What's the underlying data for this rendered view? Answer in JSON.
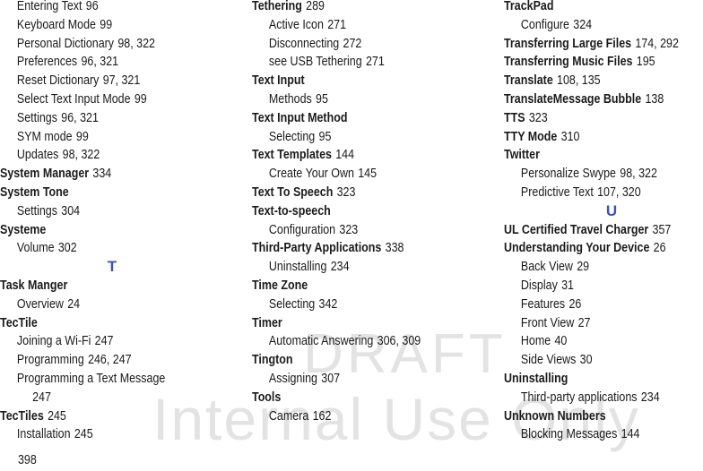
{
  "watermark": {
    "line1": "DRAFT",
    "line2": "Internal Use Only"
  },
  "page_number": "398",
  "accent_color": "#3f51b5",
  "columns": [
    {
      "entries": [
        {
          "type": "sub",
          "term": "Entering Text",
          "pages": "96"
        },
        {
          "type": "sub",
          "term": "Keyboard Mode",
          "pages": "99"
        },
        {
          "type": "sub",
          "term": "Personal Dictionary",
          "pages": "98, 322"
        },
        {
          "type": "sub",
          "term": "Preferences",
          "pages": "96, 321"
        },
        {
          "type": "sub",
          "term": "Reset Dictionary",
          "pages": "97, 321"
        },
        {
          "type": "sub",
          "term": "Select Text Input Mode",
          "pages": "99"
        },
        {
          "type": "sub",
          "term": "Settings",
          "pages": "96, 321"
        },
        {
          "type": "sub",
          "term": "SYM mode",
          "pages": "99"
        },
        {
          "type": "sub",
          "term": "Updates",
          "pages": "98, 322"
        },
        {
          "type": "main",
          "term": "System Manager",
          "pages": "334"
        },
        {
          "type": "main",
          "term": "System Tone",
          "pages": ""
        },
        {
          "type": "sub",
          "term": "Settings",
          "pages": "304"
        },
        {
          "type": "main",
          "term": "Systeme",
          "pages": ""
        },
        {
          "type": "sub",
          "term": "Volume",
          "pages": "302"
        },
        {
          "type": "letter",
          "term": "T",
          "pages": ""
        },
        {
          "type": "main",
          "term": "Task Manger",
          "pages": ""
        },
        {
          "type": "sub",
          "term": "Overview",
          "pages": "24"
        },
        {
          "type": "main",
          "term": "TecTile",
          "pages": ""
        },
        {
          "type": "sub",
          "term": "Joining a Wi-Fi",
          "pages": "247"
        },
        {
          "type": "sub",
          "term": "Programming",
          "pages": "246, 247"
        },
        {
          "type": "sub",
          "term": "Programming a Text Message",
          "pages": ""
        },
        {
          "type": "cont",
          "term": "",
          "pages": "247"
        },
        {
          "type": "main",
          "term": "TecTiles",
          "pages": "245"
        },
        {
          "type": "sub",
          "term": "Installation",
          "pages": "245"
        }
      ]
    },
    {
      "entries": [
        {
          "type": "main",
          "term": "Tethering",
          "pages": "289"
        },
        {
          "type": "sub",
          "term": "Active Icon",
          "pages": "271"
        },
        {
          "type": "sub",
          "term": "Disconnecting",
          "pages": "272"
        },
        {
          "type": "sub",
          "term": "see USB Tethering",
          "pages": "271"
        },
        {
          "type": "main",
          "term": "Text Input",
          "pages": ""
        },
        {
          "type": "sub",
          "term": "Methods",
          "pages": "95"
        },
        {
          "type": "main",
          "term": "Text Input Method",
          "pages": ""
        },
        {
          "type": "sub",
          "term": "Selecting",
          "pages": "95"
        },
        {
          "type": "main",
          "term": "Text Templates",
          "pages": "144"
        },
        {
          "type": "sub",
          "term": "Create Your Own",
          "pages": "145"
        },
        {
          "type": "main",
          "term": "Text To Speech",
          "pages": "323"
        },
        {
          "type": "main",
          "term": "Text-to-speech",
          "pages": ""
        },
        {
          "type": "sub",
          "term": "Configuration",
          "pages": "323"
        },
        {
          "type": "main",
          "term": "Third-Party Applications",
          "pages": "338"
        },
        {
          "type": "sub",
          "term": "Uninstalling",
          "pages": "234"
        },
        {
          "type": "main",
          "term": "Time Zone",
          "pages": ""
        },
        {
          "type": "sub",
          "term": "Selecting",
          "pages": "342"
        },
        {
          "type": "main",
          "term": "Timer",
          "pages": ""
        },
        {
          "type": "sub",
          "term": "Automatic Answering",
          "pages": "306, 309"
        },
        {
          "type": "main",
          "term": "Tington",
          "pages": ""
        },
        {
          "type": "sub",
          "term": "Assigning",
          "pages": "307"
        },
        {
          "type": "main",
          "term": "Tools",
          "pages": ""
        },
        {
          "type": "sub",
          "term": "Camera",
          "pages": "162"
        }
      ]
    },
    {
      "entries": [
        {
          "type": "main",
          "term": "TrackPad",
          "pages": ""
        },
        {
          "type": "sub",
          "term": "Configure",
          "pages": "324"
        },
        {
          "type": "main",
          "term": "Transferring Large Files",
          "pages": "174, 292"
        },
        {
          "type": "main",
          "term": "Transferring Music Files",
          "pages": "195"
        },
        {
          "type": "main",
          "term": "Translate",
          "pages": "108, 135"
        },
        {
          "type": "main",
          "term": "TranslateMessage Bubble",
          "pages": "138"
        },
        {
          "type": "main",
          "term": "TTS",
          "pages": "323"
        },
        {
          "type": "main",
          "term": "TTY Mode",
          "pages": "310"
        },
        {
          "type": "main",
          "term": "Twitter",
          "pages": ""
        },
        {
          "type": "sub",
          "term": "Personalize Swype",
          "pages": "98, 322"
        },
        {
          "type": "sub",
          "term": "Predictive Text",
          "pages": "107, 320"
        },
        {
          "type": "letter",
          "term": "U",
          "pages": ""
        },
        {
          "type": "main",
          "term": "UL Certified Travel Charger",
          "pages": "357"
        },
        {
          "type": "main",
          "term": "Understanding Your Device",
          "pages": "26"
        },
        {
          "type": "sub",
          "term": "Back View",
          "pages": "29"
        },
        {
          "type": "sub",
          "term": "Display",
          "pages": "31"
        },
        {
          "type": "sub",
          "term": "Features",
          "pages": "26"
        },
        {
          "type": "sub",
          "term": "Front View",
          "pages": "27"
        },
        {
          "type": "sub",
          "term": "Home",
          "pages": "40"
        },
        {
          "type": "sub",
          "term": "Side Views",
          "pages": "30"
        },
        {
          "type": "main",
          "term": "Uninstalling",
          "pages": ""
        },
        {
          "type": "sub",
          "term": "Third-party applications",
          "pages": "234"
        },
        {
          "type": "main",
          "term": "Unknown Numbers",
          "pages": ""
        },
        {
          "type": "sub",
          "term": "Blocking Messages",
          "pages": "144"
        }
      ]
    }
  ]
}
